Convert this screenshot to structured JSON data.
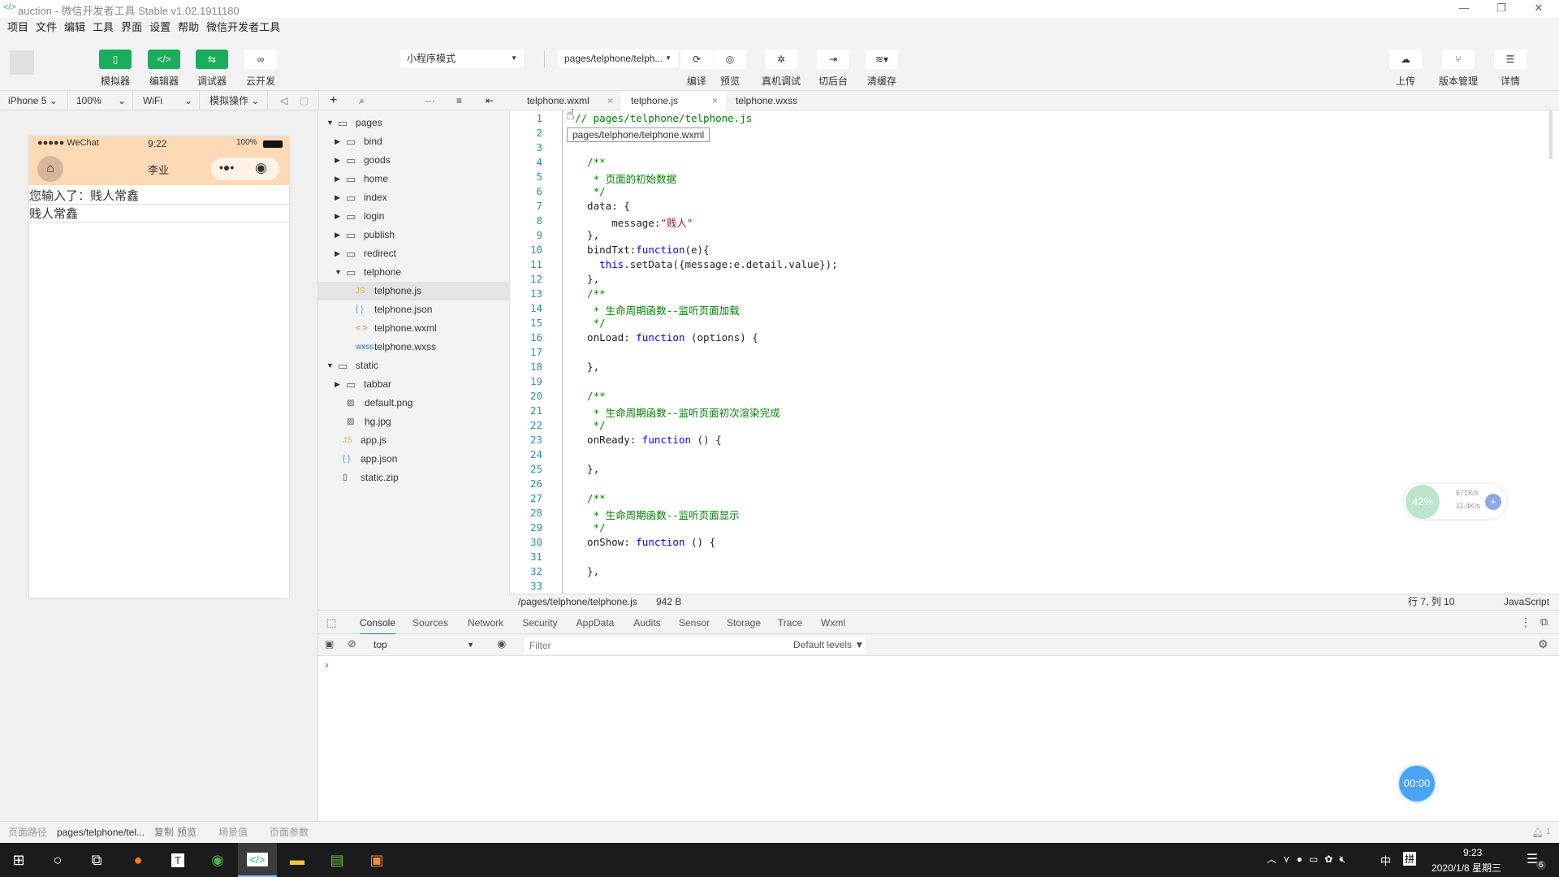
{
  "window": {
    "title": "auction - 微信开发者工具 Stable v1.02.1911180"
  },
  "menu": [
    "项目",
    "文件",
    "编辑",
    "工具",
    "界面",
    "设置",
    "帮助",
    "微信开发者工具"
  ],
  "toolbar": {
    "left": [
      {
        "label": "模拟器",
        "icon": "phone-icon",
        "active": true
      },
      {
        "label": "编辑器",
        "icon": "code-icon",
        "active": true
      },
      {
        "label": "调试器",
        "icon": "debug-icon",
        "active": true
      },
      {
        "label": "云开发",
        "icon": "cloud-icon",
        "active": false
      }
    ],
    "mode": "小程序模式",
    "page": "pages/telphone/telph...",
    "middle": [
      {
        "label": "编译",
        "icon": "refresh-icon"
      },
      {
        "label": "预览",
        "icon": "eye-icon"
      },
      {
        "label": "真机调试",
        "icon": "bug-icon"
      },
      {
        "label": "切后台",
        "icon": "switch-background-icon"
      },
      {
        "label": "清缓存",
        "icon": "layers-icon"
      }
    ],
    "right": [
      {
        "label": "上传",
        "icon": "upload-icon"
      },
      {
        "label": "版本管理",
        "icon": "branch-icon"
      },
      {
        "label": "详情",
        "icon": "menu-icon"
      }
    ]
  },
  "simbar": {
    "device": "iPhone 5",
    "zoom": "100%",
    "network": "WiFi",
    "ops": "模拟操作"
  },
  "phone": {
    "carrier": "●●●●● WeChat",
    "time": "9:22",
    "battery": "100%",
    "nav_title": "李业",
    "output_text": "您输入了：贱人常鑫",
    "input_value": "贱人常鑫",
    "navbar_color": "#fdd9b5"
  },
  "tree": [
    {
      "name": "pages",
      "type": "folder",
      "open": true,
      "depth": 0
    },
    {
      "name": "bind",
      "type": "folder",
      "depth": 1
    },
    {
      "name": "goods",
      "type": "folder",
      "depth": 1
    },
    {
      "name": "home",
      "type": "folder",
      "depth": 1
    },
    {
      "name": "index",
      "type": "folder",
      "depth": 1
    },
    {
      "name": "login",
      "type": "folder",
      "depth": 1
    },
    {
      "name": "publish",
      "type": "folder",
      "depth": 1
    },
    {
      "name": "redirect",
      "type": "folder",
      "depth": 1
    },
    {
      "name": "telphone",
      "type": "folder",
      "open": true,
      "depth": 1
    },
    {
      "name": "telphone.js",
      "type": "js",
      "depth": 2,
      "selected": true
    },
    {
      "name": "telphone.json",
      "type": "json",
      "depth": 2
    },
    {
      "name": "telphone.wxml",
      "type": "wxml",
      "depth": 2
    },
    {
      "name": "telphone.wxss",
      "type": "wxss",
      "depth": 2
    },
    {
      "name": "static",
      "type": "folder",
      "open": true,
      "depth": 0
    },
    {
      "name": "tabbar",
      "type": "folder",
      "depth": 1
    },
    {
      "name": "default.png",
      "type": "image",
      "depth": 1
    },
    {
      "name": "hg.jpg",
      "type": "image",
      "depth": 1
    },
    {
      "name": "app.js",
      "type": "js",
      "depth": 0.5
    },
    {
      "name": "app.json",
      "type": "json",
      "depth": 0.5
    },
    {
      "name": "static.zip",
      "type": "file",
      "depth": 0.5
    }
  ],
  "tabs": [
    {
      "label": "telphone.wxml",
      "closable": true
    },
    {
      "label": "telphone.js",
      "closable": true,
      "active": true
    },
    {
      "label": "telphone.wxss"
    }
  ],
  "tooltip": "pages/telphone/telphone.wxml",
  "code": [
    [
      [
        "c",
        "// pages/telphone/telphone.js"
      ]
    ],
    [
      [
        "p",
        "Page({"
      ]
    ],
    [],
    [
      [
        "c",
        "  /**"
      ]
    ],
    [
      [
        "c",
        "   * 页面的初始数据"
      ]
    ],
    [
      [
        "c",
        "   */"
      ]
    ],
    [
      [
        "p",
        "  data: {"
      ]
    ],
    [
      [
        "p",
        "      message:"
      ],
      [
        "s",
        "\"贱人\""
      ]
    ],
    [
      [
        "p",
        "  },"
      ]
    ],
    [
      [
        "p",
        "  bindTxt:"
      ],
      [
        "k",
        "function"
      ],
      [
        "p",
        "(e){"
      ]
    ],
    [
      [
        "p",
        "    "
      ],
      [
        "k",
        "this"
      ],
      [
        "p",
        ".setData({message:e.detail.value});"
      ]
    ],
    [
      [
        "p",
        "  },"
      ]
    ],
    [
      [
        "c",
        "  /**"
      ]
    ],
    [
      [
        "c",
        "   * 生命周期函数--监听页面加载"
      ]
    ],
    [
      [
        "c",
        "   */"
      ]
    ],
    [
      [
        "p",
        "  onLoad: "
      ],
      [
        "k",
        "function"
      ],
      [
        "p",
        " (options) {"
      ]
    ],
    [],
    [
      [
        "p",
        "  },"
      ]
    ],
    [],
    [
      [
        "c",
        "  /**"
      ]
    ],
    [
      [
        "c",
        "   * 生命周期函数--监听页面初次渲染完成"
      ]
    ],
    [
      [
        "c",
        "   */"
      ]
    ],
    [
      [
        "p",
        "  onReady: "
      ],
      [
        "k",
        "function"
      ],
      [
        "p",
        " () {"
      ]
    ],
    [],
    [
      [
        "p",
        "  },"
      ]
    ],
    [],
    [
      [
        "c",
        "  /**"
      ]
    ],
    [
      [
        "c",
        "   * 生命周期函数--监听页面显示"
      ]
    ],
    [
      [
        "c",
        "   */"
      ]
    ],
    [
      [
        "p",
        "  onShow: "
      ],
      [
        "k",
        "function"
      ],
      [
        "p",
        " () {"
      ]
    ],
    [],
    [
      [
        "p",
        "  },"
      ]
    ],
    []
  ],
  "editor_status": {
    "path": "/pages/telphone/telphone.js",
    "size": "942 B",
    "cursor": "行 7, 列 10",
    "language": "JavaScript"
  },
  "devtools": {
    "tabs": [
      "Console",
      "Sources",
      "Network",
      "Security",
      "AppData",
      "Audits",
      "Sensor",
      "Storage",
      "Trace",
      "Wxml"
    ],
    "active": "Console",
    "context": "top",
    "filter_placeholder": "Filter",
    "levels": "Default levels ▼",
    "prompt": "›"
  },
  "footer": {
    "path_label": "页面路径",
    "path": "pages/telphone/tel...",
    "copy": "复制",
    "preview": "预览",
    "scene": "场景值",
    "params": "页面参数",
    "notifications": "1"
  },
  "netwidget": {
    "percent": "42%",
    "up": "671K/s",
    "down": "11.4K/s"
  },
  "timer": "00:00",
  "taskbar": {
    "time": "9:23",
    "date": "2020/1/8 星期三",
    "ime": "中",
    "ime2": "拼",
    "notif_count": "6"
  }
}
